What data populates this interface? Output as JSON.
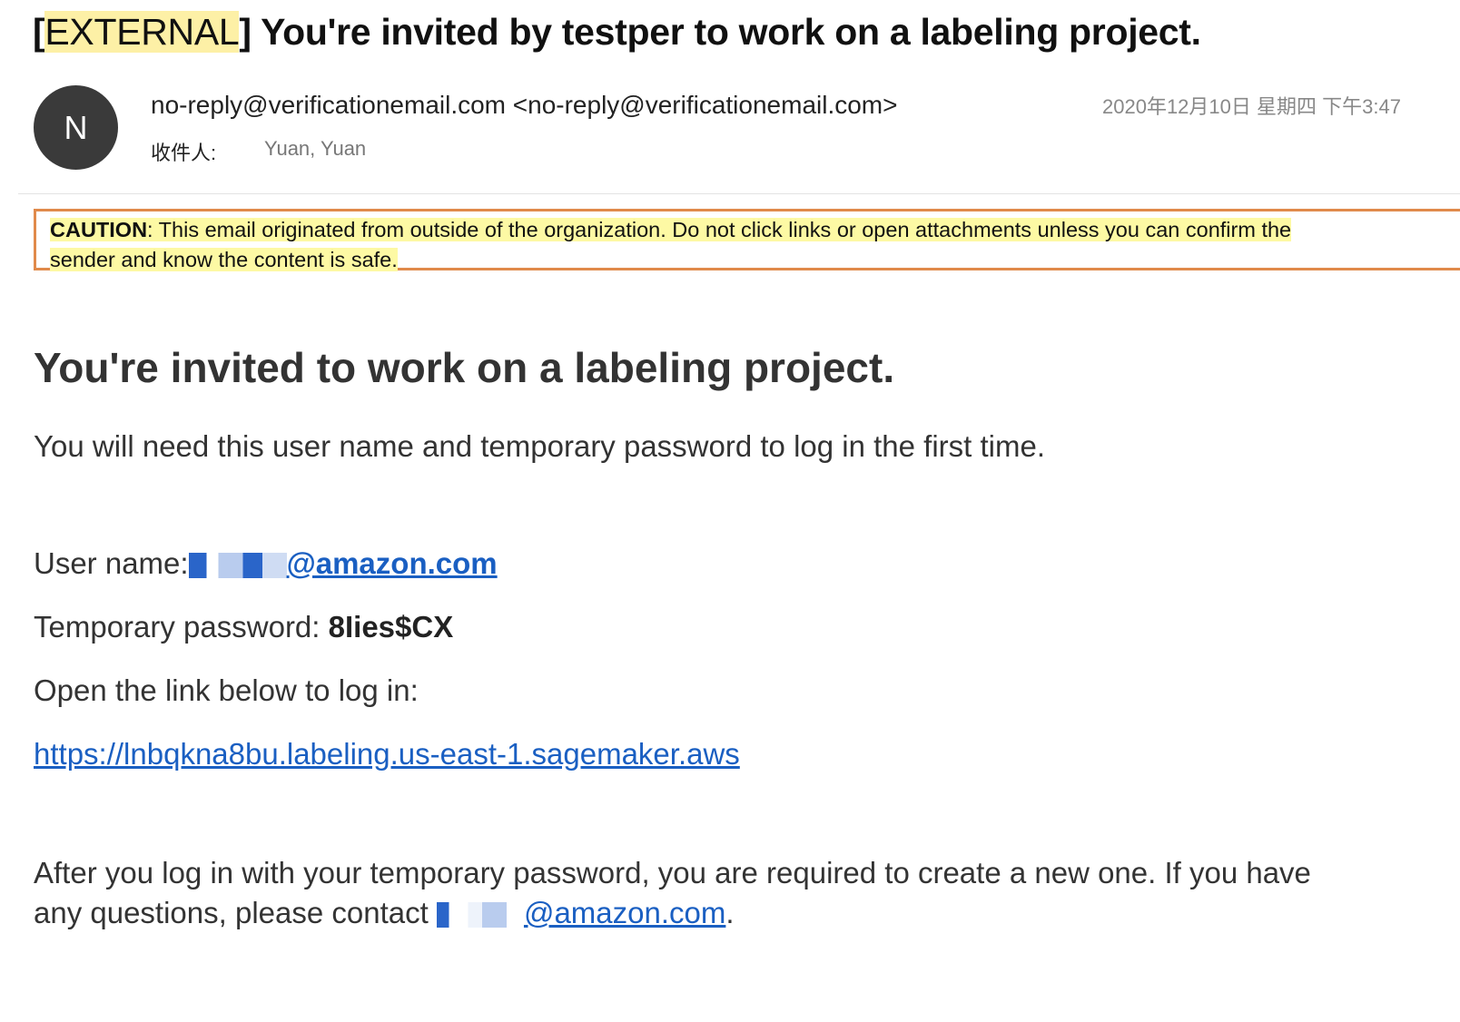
{
  "email": {
    "subject_tag": "EXTERNAL",
    "subject_text": "You're invited by testper to work on a labeling project.",
    "avatar_letter": "N",
    "from": "no-reply@verificationemail.com <no-reply@verificationemail.com>",
    "to_label": "收件人:",
    "to_value": "Yuan, Yuan",
    "date": "2020年12月10日 星期四 下午3:47"
  },
  "caution": {
    "label": "CAUTION",
    "line1_rest": ": This email originated from outside of the organization. Do not click links or open attachments unless you can confirm the",
    "line2": "sender and know the content is safe."
  },
  "body": {
    "title": "You're invited to work on a labeling project.",
    "intro": "You will need this user name and temporary password to log in the first time.",
    "username_label": "User name:",
    "username_domain": "@amazon.com",
    "password_label": "Temporary password: ",
    "password_value": "8Iies$CX",
    "open_link_text": "Open the link below to log in:",
    "login_url": "https://lnbqkna8bu.labeling.us-east-1.sagemaker.aws",
    "after_line1": "After you log in with your temporary password, you are required to create a new one. If you have",
    "after_line2_prefix": "any questions, please contact ",
    "contact_domain": "@amazon.com",
    "after_line2_suffix": "."
  },
  "colors": {
    "highlight": "#fdf0a6",
    "caution_border": "#e08a4b",
    "link": "#1a5fc2",
    "avatar_bg": "#3a3a3a"
  }
}
